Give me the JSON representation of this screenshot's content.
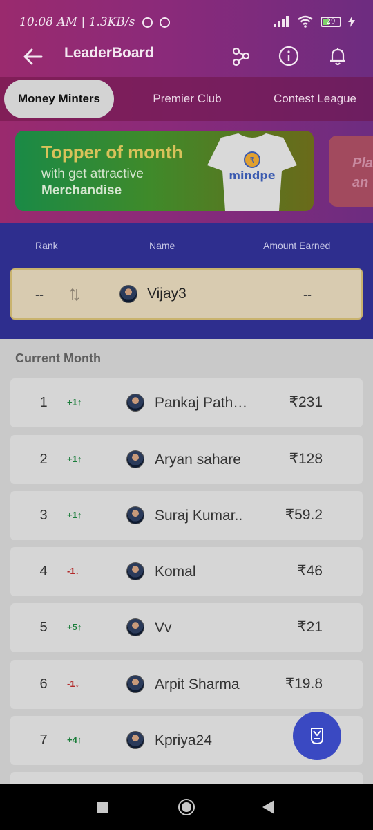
{
  "status_bar": {
    "time": "10:08 AM",
    "speed": "1.3KB/s",
    "battery": "29"
  },
  "header": {
    "title": "LeaderBoard"
  },
  "icons": {
    "back": "back-arrow-icon",
    "share": "share-icon",
    "info": "info-icon",
    "notifications": "bell-icon"
  },
  "tabs": [
    {
      "label": "Money Minters",
      "active": true
    },
    {
      "label": "Premier Club",
      "active": false
    },
    {
      "label": "Contest League",
      "active": false
    }
  ],
  "banner": {
    "title": "Topper of month",
    "subtitle": "with get attractive",
    "subtitle_bold": "Merchandise",
    "brand": "mindpe"
  },
  "banner2": {
    "line1": "Pla",
    "line2": "an"
  },
  "table_header": {
    "rank": "Rank",
    "name": "Name",
    "amount": "Amount Earned"
  },
  "my_entry": {
    "rank": "--",
    "name": "Vijay3",
    "amount": "--"
  },
  "section_title": "Current Month",
  "leaderboard": [
    {
      "rank": "1",
      "change": "+1↑",
      "direction": "up",
      "name": "Pankaj Path…",
      "amount": "₹231"
    },
    {
      "rank": "2",
      "change": "+1↑",
      "direction": "up",
      "name": "Aryan sahare",
      "amount": "₹128"
    },
    {
      "rank": "3",
      "change": "+1↑",
      "direction": "up",
      "name": "Suraj Kumar..",
      "amount": "₹59.2"
    },
    {
      "rank": "4",
      "change": "-1↓",
      "direction": "down",
      "name": "Komal",
      "amount": "₹46"
    },
    {
      "rank": "5",
      "change": "+5↑",
      "direction": "up",
      "name": "Vv",
      "amount": "₹21"
    },
    {
      "rank": "6",
      "change": "-1↓",
      "direction": "down",
      "name": "Arpit Sharma",
      "amount": "₹19.8"
    },
    {
      "rank": "7",
      "change": "+4↑",
      "direction": "up",
      "name": "Kpriya24",
      "amount": "₹"
    }
  ],
  "colors": {
    "header_gradient_start": "#9a2a6e",
    "header_gradient_end": "#6d2c80",
    "table_band": "#2e2e8e",
    "my_row": "#d8cbb0",
    "up": "#1a7d3a",
    "down": "#b22a2a",
    "fab": "#3a49c2"
  }
}
